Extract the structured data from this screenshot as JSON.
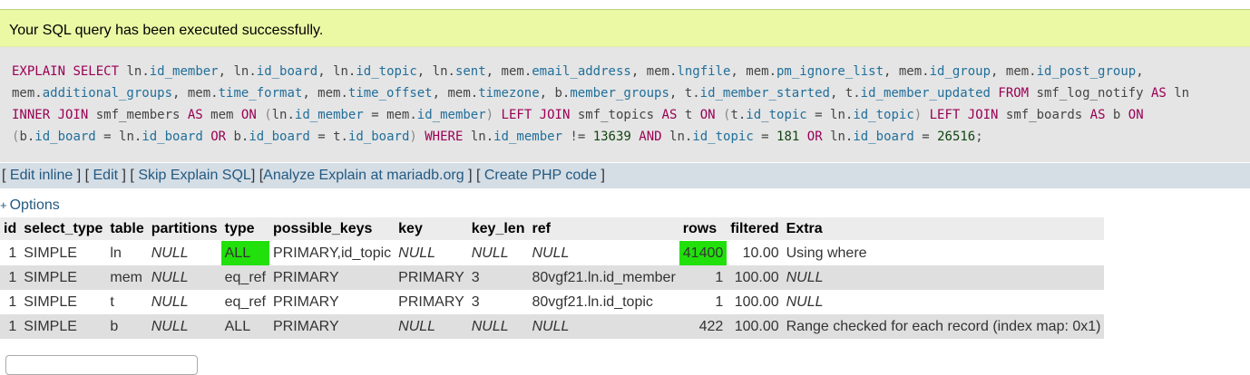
{
  "success_message": "Your SQL query has been executed successfully.",
  "sql_lines": [
    [
      [
        "kw",
        "EXPLAIN"
      ],
      [
        "t",
        " "
      ],
      [
        "kw",
        "SELECT"
      ],
      [
        "t",
        " ln."
      ],
      [
        "prop",
        "id_member"
      ],
      [
        "t",
        ", ln."
      ],
      [
        "prop",
        "id_board"
      ],
      [
        "t",
        ", ln."
      ],
      [
        "prop",
        "id_topic"
      ],
      [
        "t",
        ", ln."
      ],
      [
        "prop",
        "sent"
      ],
      [
        "t",
        ", mem."
      ],
      [
        "prop",
        "email_address"
      ],
      [
        "t",
        ", mem."
      ],
      [
        "prop",
        "lngfile"
      ],
      [
        "t",
        ", mem."
      ],
      [
        "prop",
        "pm_ignore_list"
      ],
      [
        "t",
        ", mem."
      ],
      [
        "prop",
        "id_group"
      ],
      [
        "t",
        ", mem."
      ],
      [
        "prop",
        "id_post_group"
      ],
      [
        "t",
        ","
      ]
    ],
    [
      [
        "t",
        "mem."
      ],
      [
        "prop",
        "additional_groups"
      ],
      [
        "t",
        ", mem."
      ],
      [
        "prop",
        "time_format"
      ],
      [
        "t",
        ", mem."
      ],
      [
        "prop",
        "time_offset"
      ],
      [
        "t",
        ", mem."
      ],
      [
        "prop",
        "timezone"
      ],
      [
        "t",
        ", b."
      ],
      [
        "prop",
        "member_groups"
      ],
      [
        "t",
        ", t."
      ],
      [
        "prop",
        "id_member_started"
      ],
      [
        "t",
        ", t."
      ],
      [
        "prop",
        "id_member_updated"
      ],
      [
        "t",
        " "
      ],
      [
        "kw",
        "FROM"
      ],
      [
        "t",
        " smf_log_notify "
      ],
      [
        "kw",
        "AS"
      ],
      [
        "t",
        " ln"
      ]
    ],
    [
      [
        "kw",
        "INNER JOIN"
      ],
      [
        "t",
        " smf_members "
      ],
      [
        "kw",
        "AS"
      ],
      [
        "t",
        " mem "
      ],
      [
        "kw",
        "ON"
      ],
      [
        "t",
        " "
      ],
      [
        "paren",
        "("
      ],
      [
        "t",
        "ln."
      ],
      [
        "prop",
        "id_member"
      ],
      [
        "t",
        " = mem."
      ],
      [
        "prop",
        "id_member"
      ],
      [
        "paren",
        ")"
      ],
      [
        "t",
        " "
      ],
      [
        "kw",
        "LEFT JOIN"
      ],
      [
        "t",
        " smf_topics "
      ],
      [
        "kw",
        "AS"
      ],
      [
        "t",
        " t "
      ],
      [
        "kw",
        "ON"
      ],
      [
        "t",
        " "
      ],
      [
        "paren",
        "("
      ],
      [
        "t",
        "t."
      ],
      [
        "prop",
        "id_topic"
      ],
      [
        "t",
        " = ln."
      ],
      [
        "prop",
        "id_topic"
      ],
      [
        "paren",
        ")"
      ],
      [
        "t",
        " "
      ],
      [
        "kw",
        "LEFT JOIN"
      ],
      [
        "t",
        " smf_boards "
      ],
      [
        "kw",
        "AS"
      ],
      [
        "t",
        " b "
      ],
      [
        "kw",
        "ON"
      ]
    ],
    [
      [
        "paren",
        "("
      ],
      [
        "t",
        "b."
      ],
      [
        "prop",
        "id_board"
      ],
      [
        "t",
        " = ln."
      ],
      [
        "prop",
        "id_board"
      ],
      [
        "t",
        " "
      ],
      [
        "kw",
        "OR"
      ],
      [
        "t",
        " b."
      ],
      [
        "prop",
        "id_board"
      ],
      [
        "t",
        " = t."
      ],
      [
        "prop",
        "id_board"
      ],
      [
        "paren",
        ")"
      ],
      [
        "t",
        " "
      ],
      [
        "kw",
        "WHERE"
      ],
      [
        "t",
        " ln."
      ],
      [
        "prop",
        "id_member"
      ],
      [
        "t",
        " != "
      ],
      [
        "num",
        "13639"
      ],
      [
        "t",
        " "
      ],
      [
        "kw",
        "AND"
      ],
      [
        "t",
        " ln."
      ],
      [
        "prop",
        "id_topic"
      ],
      [
        "t",
        " = "
      ],
      [
        "num",
        "181"
      ],
      [
        "t",
        " "
      ],
      [
        "kw",
        "OR"
      ],
      [
        "t",
        " ln."
      ],
      [
        "prop",
        "id_board"
      ],
      [
        "t",
        " = "
      ],
      [
        "num",
        "26516"
      ],
      [
        "t",
        ";"
      ]
    ]
  ],
  "links": {
    "edit_inline": "Edit inline",
    "edit": "Edit",
    "skip_explain": "Skip Explain SQL",
    "analyze": "Analyze Explain at mariadb.org",
    "create_php": "Create PHP code"
  },
  "options_label": "Options",
  "columns": [
    "id",
    "select_type",
    "table",
    "partitions",
    "type",
    "possible_keys",
    "key",
    "key_len",
    "ref",
    "rows",
    "filtered",
    "Extra"
  ],
  "rows": [
    [
      "1",
      "SIMPLE",
      "ln",
      "NULL",
      "ALL",
      "PRIMARY,id_topic",
      "NULL",
      "NULL",
      "NULL",
      "41400",
      "10.00",
      "Using where"
    ],
    [
      "1",
      "SIMPLE",
      "mem",
      "NULL",
      "eq_ref",
      "PRIMARY",
      "PRIMARY",
      "3",
      "80vgf21.ln.id_member",
      "1",
      "100.00",
      "NULL"
    ],
    [
      "1",
      "SIMPLE",
      "t",
      "NULL",
      "eq_ref",
      "PRIMARY",
      "PRIMARY",
      "3",
      "80vgf21.ln.id_topic",
      "1",
      "100.00",
      "NULL"
    ],
    [
      "1",
      "SIMPLE",
      "b",
      "NULL",
      "ALL",
      "PRIMARY",
      "NULL",
      "NULL",
      "NULL",
      "422",
      "100.00",
      "Range checked for each record (index map: 0x1)"
    ]
  ],
  "highlight_color": "#22e00b"
}
